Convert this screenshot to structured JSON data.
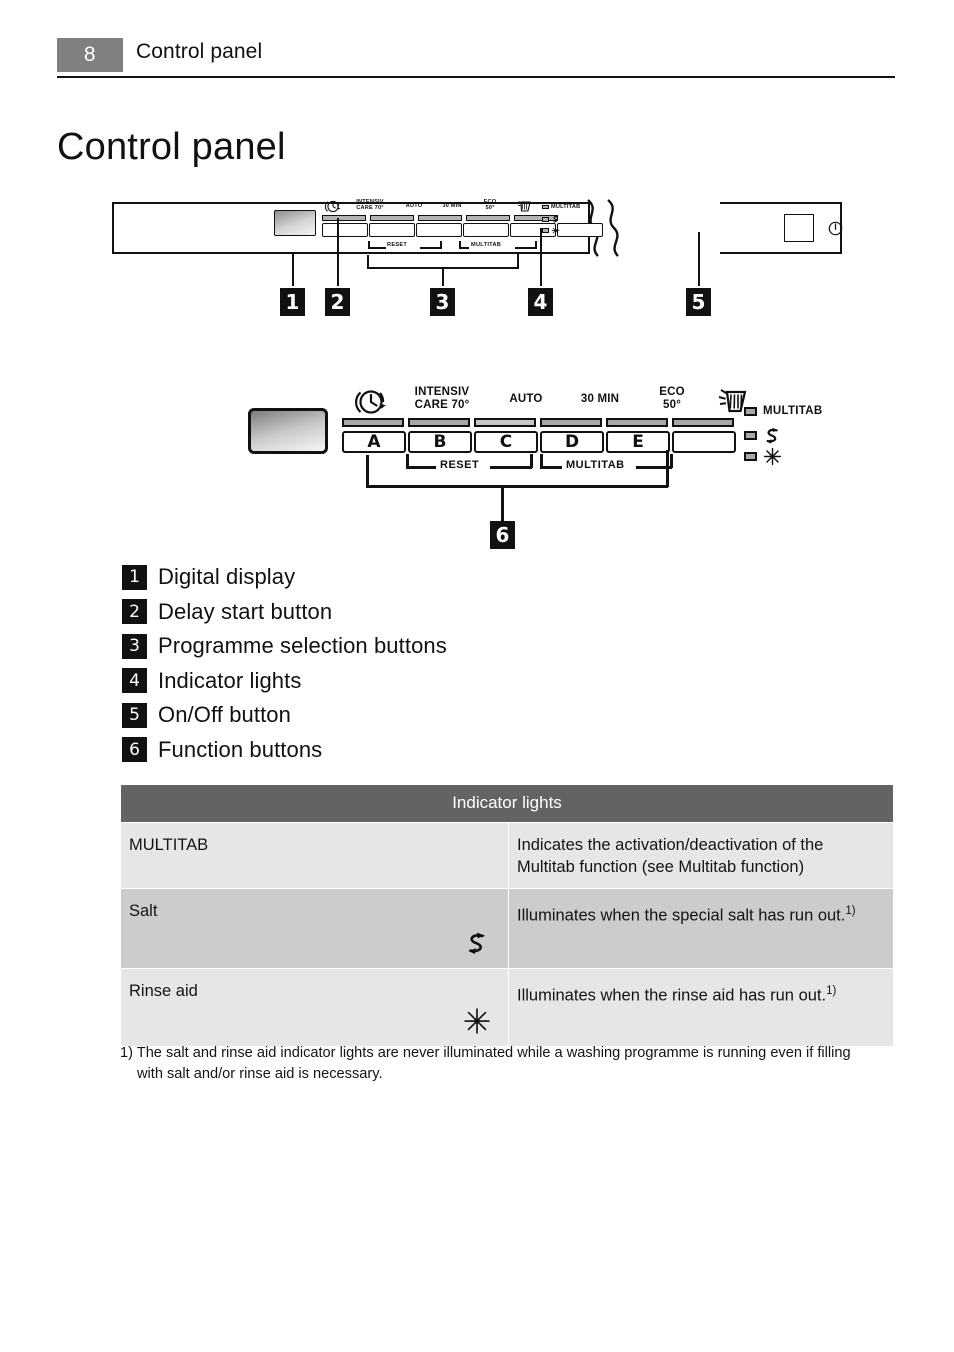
{
  "header": {
    "page_number": "8",
    "running_title": "Control panel"
  },
  "section": {
    "title": "Control panel"
  },
  "figure1": {
    "programme_labels": [
      "",
      "INTENSIV\nCARE 70°",
      "AUTO",
      "30 MIN",
      "ECO\n50°",
      ""
    ],
    "delay_icon": "delay-start-icon",
    "rinse_icon": "rinse-spray-icon",
    "bracket_reset": "RESET",
    "bracket_multitab": "MULTITAB",
    "indicators": [
      {
        "label": "MULTITAB",
        "icon": "multitab-led-icon"
      },
      {
        "label": "",
        "icon": "salt-icon"
      },
      {
        "label": "",
        "icon": "rinse-aid-icon"
      }
    ],
    "power_icon": "power-symbol-icon",
    "callouts": [
      "1",
      "2",
      "3",
      "4",
      "5"
    ]
  },
  "figure2": {
    "programme_labels": [
      "",
      "INTENSIV\nCARE 70°",
      "AUTO",
      "30 MIN",
      "ECO\n50°",
      ""
    ],
    "delay_icon": "delay-start-icon",
    "rinse_icon": "rinse-spray-icon",
    "button_letters": [
      "A",
      "B",
      "C",
      "D",
      "E",
      ""
    ],
    "bracket_reset": "RESET",
    "bracket_multitab": "MULTITAB",
    "indicators": [
      {
        "label": "MULTITAB",
        "icon": "multitab-led-icon"
      },
      {
        "label": "",
        "icon": "salt-icon"
      },
      {
        "label": "",
        "icon": "rinse-aid-icon"
      }
    ],
    "callout": "6"
  },
  "legend": [
    {
      "num": "1",
      "label": "Digital display"
    },
    {
      "num": "2",
      "label": "Delay start button"
    },
    {
      "num": "3",
      "label": "Programme selection buttons"
    },
    {
      "num": "4",
      "label": "Indicator lights"
    },
    {
      "num": "5",
      "label": "On/Off button"
    },
    {
      "num": "6",
      "label": "Function buttons"
    }
  ],
  "table": {
    "header": "Indicator lights",
    "rows": [
      {
        "name": "MULTITAB",
        "icon": "",
        "description": "Indicates the activation/deactivation of the Multitab function (see Multitab function)",
        "footnote_marker": ""
      },
      {
        "name": "Salt",
        "icon": "salt-icon",
        "description": "Illuminates when the special salt has run out.",
        "footnote_marker": "1)"
      },
      {
        "name": "Rinse aid",
        "icon": "rinse-aid-icon",
        "description": "Illuminates when the rinse aid has run out.",
        "footnote_marker": "1)"
      }
    ]
  },
  "footnote": {
    "marker": "1)",
    "line1": "The salt and rinse aid indicator lights are never illuminated while a washing programme is running even if filling",
    "line2": "with salt and/or rinse aid is necessary."
  },
  "colors": {
    "page_number_bg": "#808080",
    "table_header_bg": "#636363",
    "row_light": "#e6e6e6",
    "row_dark": "#cccccc",
    "ink": "#111111"
  }
}
